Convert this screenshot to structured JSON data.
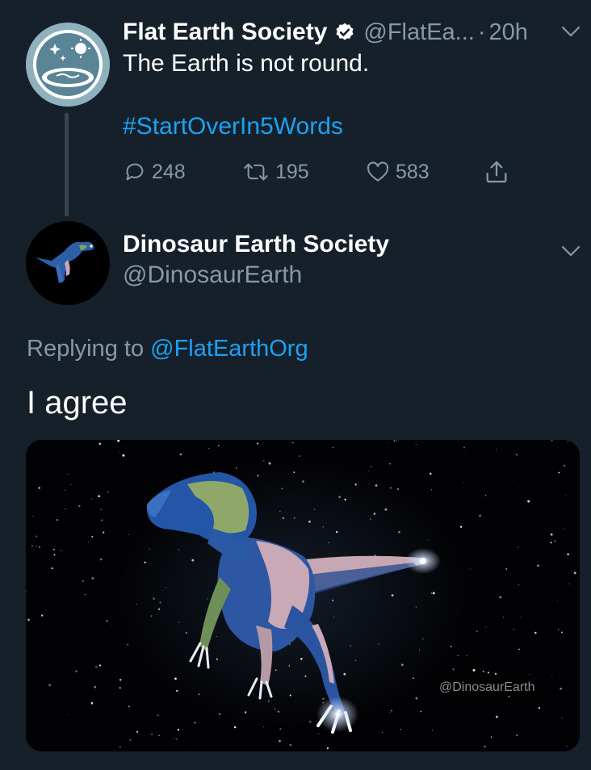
{
  "parent_tweet": {
    "name": "Flat Earth Society",
    "handle": "@FlatEa...",
    "separator": "·",
    "time": "20h",
    "text": "The Earth is not round.",
    "hashtag": "#StartOverIn5Words",
    "replies": "248",
    "retweets": "195",
    "likes": "583"
  },
  "reply_tweet": {
    "name": "Dinosaur Earth Society",
    "handle": "@DinosaurEarth",
    "replying_prefix": "Replying to",
    "replying_to": "@FlatEarthOrg",
    "text": "I agree",
    "media_watermark": "@DinosaurEarth"
  },
  "colors": {
    "background": "#15202b",
    "text_primary": "#ffffff",
    "text_secondary": "#8899a6",
    "accent": "#1da1f2",
    "thread_line": "#38444d"
  },
  "icons": [
    "verified-badge-icon",
    "chevron-down-icon",
    "reply-icon",
    "retweet-icon",
    "like-icon",
    "share-icon"
  ]
}
